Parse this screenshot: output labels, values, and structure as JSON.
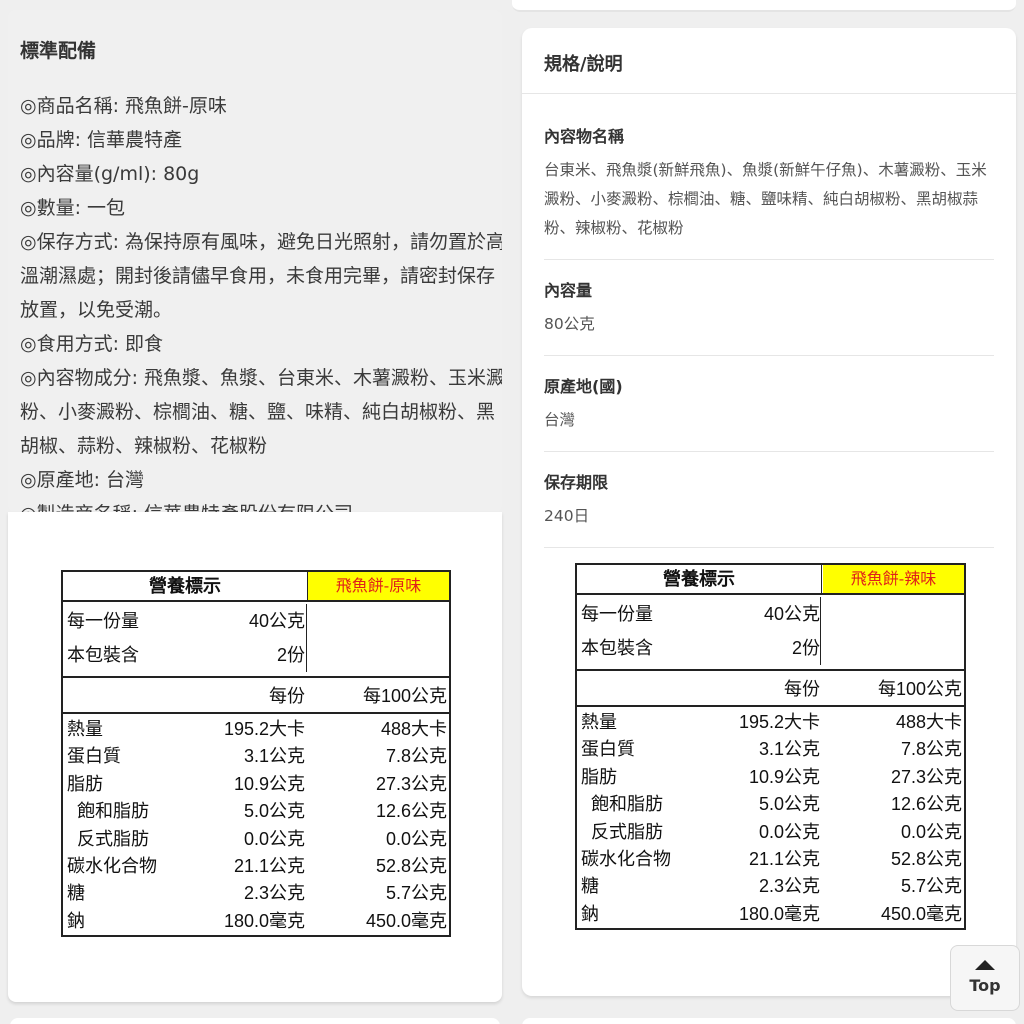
{
  "spec": {
    "title": "標準配備",
    "lines": [
      "◎商品名稱: 飛魚餅-原味",
      "◎品牌: 信華農特產",
      "◎內容量(g/ml): 80g",
      "◎數量: 一包",
      "◎保存方式: 為保持原有風味，避免日光照射，請勿置於高溫潮濕處；開封後請儘早食用，未食用完畢，請密封保存放置，以免受潮。",
      "◎食用方式: 即食",
      "◎內容物成分: 飛魚漿、魚漿、台東米、木薯澱粉、玉米澱粉、小麥澱粉、棕櫚油、糖、鹽、味精、純白胡椒粉、黑胡椒、蒜粉、辣椒粉、花椒粉",
      "◎原產地: 台灣",
      "◎製造商名稱: 信華農特產股份有限公司"
    ]
  },
  "details": {
    "title": "規格/說明",
    "items": [
      {
        "label": "內容物名稱",
        "value": "台東米、飛魚漿(新鮮飛魚)、魚漿(新鮮午仔魚)、木薯澱粉、玉米澱粉、小麥澱粉、棕櫚油、糖、鹽味精、純白胡椒粉、黑胡椒蒜粉、辣椒粉、花椒粉"
      },
      {
        "label": "內容量",
        "value": "80公克"
      },
      {
        "label": "原產地(國)",
        "value": "台灣"
      },
      {
        "label": "保存期限",
        "value": "240日"
      }
    ]
  },
  "nutrition_left": {
    "title": "營養標示",
    "flavor": "飛魚餅-原味",
    "serving_label": "每一份量",
    "serving_value": "40公克",
    "pack_label": "本包裝含",
    "pack_value": "2份",
    "col_per_serving": "每份",
    "col_per_100g": "每100公克",
    "rows": [
      {
        "name": "熱量",
        "a": "195.2大卡",
        "b": "488大卡"
      },
      {
        "name": "蛋白質",
        "a": "3.1公克",
        "b": "7.8公克"
      },
      {
        "name": "脂肪",
        "a": "10.9公克",
        "b": "27.3公克"
      },
      {
        "name": "飽和脂肪",
        "a": "5.0公克",
        "b": "12.6公克"
      },
      {
        "name": "反式脂肪",
        "a": "0.0公克",
        "b": "0.0公克"
      },
      {
        "name": "碳水化合物",
        "a": "21.1公克",
        "b": "52.8公克"
      },
      {
        "name": "糖",
        "a": "2.3公克",
        "b": "5.7公克"
      },
      {
        "name": "鈉",
        "a": "180.0毫克",
        "b": "450.0毫克"
      }
    ]
  },
  "nutrition_right": {
    "title": "營養標示",
    "flavor": "飛魚餅-辣味",
    "serving_label": "每一份量",
    "serving_value": "40公克",
    "pack_label": "本包裝含",
    "pack_value": "2份",
    "col_per_serving": "每份",
    "col_per_100g": "每100公克",
    "rows": [
      {
        "name": "熱量",
        "a": "195.2大卡",
        "b": "488大卡"
      },
      {
        "name": "蛋白質",
        "a": "3.1公克",
        "b": "7.8公克"
      },
      {
        "name": "脂肪",
        "a": "10.9公克",
        "b": "27.3公克"
      },
      {
        "name": "飽和脂肪",
        "a": "5.0公克",
        "b": "12.6公克"
      },
      {
        "name": "反式脂肪",
        "a": "0.0公克",
        "b": "0.0公克"
      },
      {
        "name": "碳水化合物",
        "a": "21.1公克",
        "b": "52.8公克"
      },
      {
        "name": "糖",
        "a": "2.3公克",
        "b": "5.7公克"
      },
      {
        "name": "鈉",
        "a": "180.0毫克",
        "b": "450.0毫克"
      }
    ]
  },
  "top_button": {
    "label": "Top",
    "icon": "arrow-up-icon"
  },
  "colors": {
    "flavor_bg": "#ffff00",
    "flavor_text": "#e0201a"
  }
}
